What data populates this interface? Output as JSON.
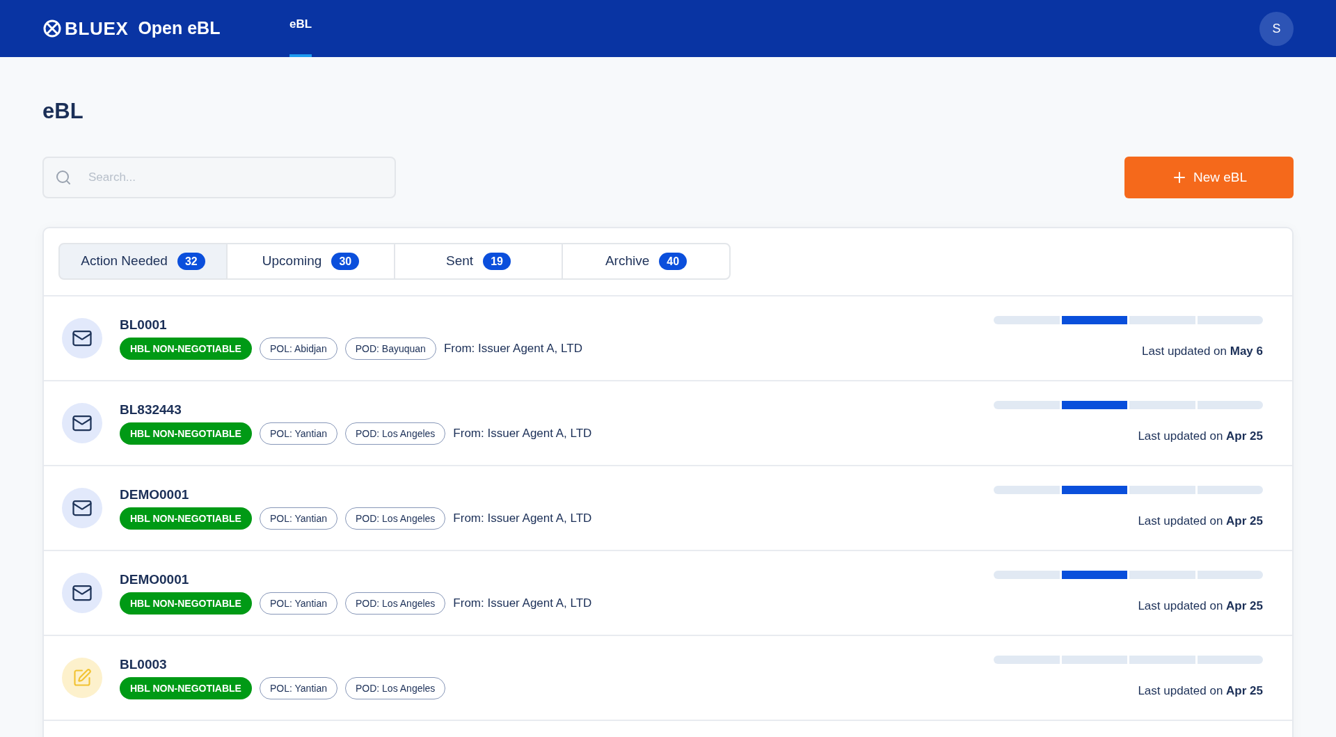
{
  "header": {
    "brand": "BLUEX",
    "product": "Open eBL",
    "nav": [
      {
        "label": "eBL",
        "selected": true
      }
    ],
    "avatar": "S"
  },
  "page_title": "eBL",
  "search": {
    "placeholder": "Search..."
  },
  "new_button": "New eBL",
  "tabs": [
    {
      "label": "Action Needed",
      "count": "32",
      "selected": true
    },
    {
      "label": "Upcoming",
      "count": "30",
      "selected": false
    },
    {
      "label": "Sent",
      "count": "19",
      "selected": false
    },
    {
      "label": "Archive",
      "count": "40",
      "selected": false
    }
  ],
  "rows": [
    {
      "kind": "mail",
      "id": "BL0001",
      "type": "HBL NON-NEGOTIABLE",
      "pol": "POL: Abidjan",
      "pod": "POD: Bayuquan",
      "from": "From: Issuer Agent A, LTD",
      "steps": [
        {
          "active": false
        },
        {
          "active": true
        },
        {
          "active": false
        },
        {
          "active": false
        }
      ],
      "updated": "Last updated on **May 6**"
    },
    {
      "kind": "mail",
      "id": "BL832443",
      "type": "HBL NON-NEGOTIABLE",
      "pol": "POL: Yantian",
      "pod": "POD: Los Angeles",
      "from": "From: Issuer Agent A, LTD",
      "steps": [
        {
          "active": false
        },
        {
          "active": true
        },
        {
          "active": false
        },
        {
          "active": false
        }
      ],
      "updated": "Last updated on **Apr 25**"
    },
    {
      "kind": "mail",
      "id": "DEMO0001",
      "type": "HBL NON-NEGOTIABLE",
      "pol": "POL: Yantian",
      "pod": "POD: Los Angeles",
      "from": "From: Issuer Agent A, LTD",
      "steps": [
        {
          "active": false
        },
        {
          "active": true
        },
        {
          "active": false
        },
        {
          "active": false
        }
      ],
      "updated": "Last updated on **Apr 25**"
    },
    {
      "kind": "mail",
      "id": "DEMO0001",
      "type": "HBL NON-NEGOTIABLE",
      "pol": "POL: Yantian",
      "pod": "POD: Los Angeles",
      "from": "From: Issuer Agent A, LTD",
      "steps": [
        {
          "active": false
        },
        {
          "active": true
        },
        {
          "active": false
        },
        {
          "active": false
        }
      ],
      "updated": "Last updated on **Apr 25**"
    },
    {
      "kind": "draft",
      "id": "BL0003",
      "type": "HBL NON-NEGOTIABLE",
      "pol": "POL: Yantian",
      "pod": "POD: Los Angeles",
      "steps": [
        {
          "active": false
        },
        {
          "active": false
        },
        {
          "active": false
        },
        {
          "active": false
        }
      ],
      "updated": "Last updated on **Apr 25**"
    }
  ]
}
